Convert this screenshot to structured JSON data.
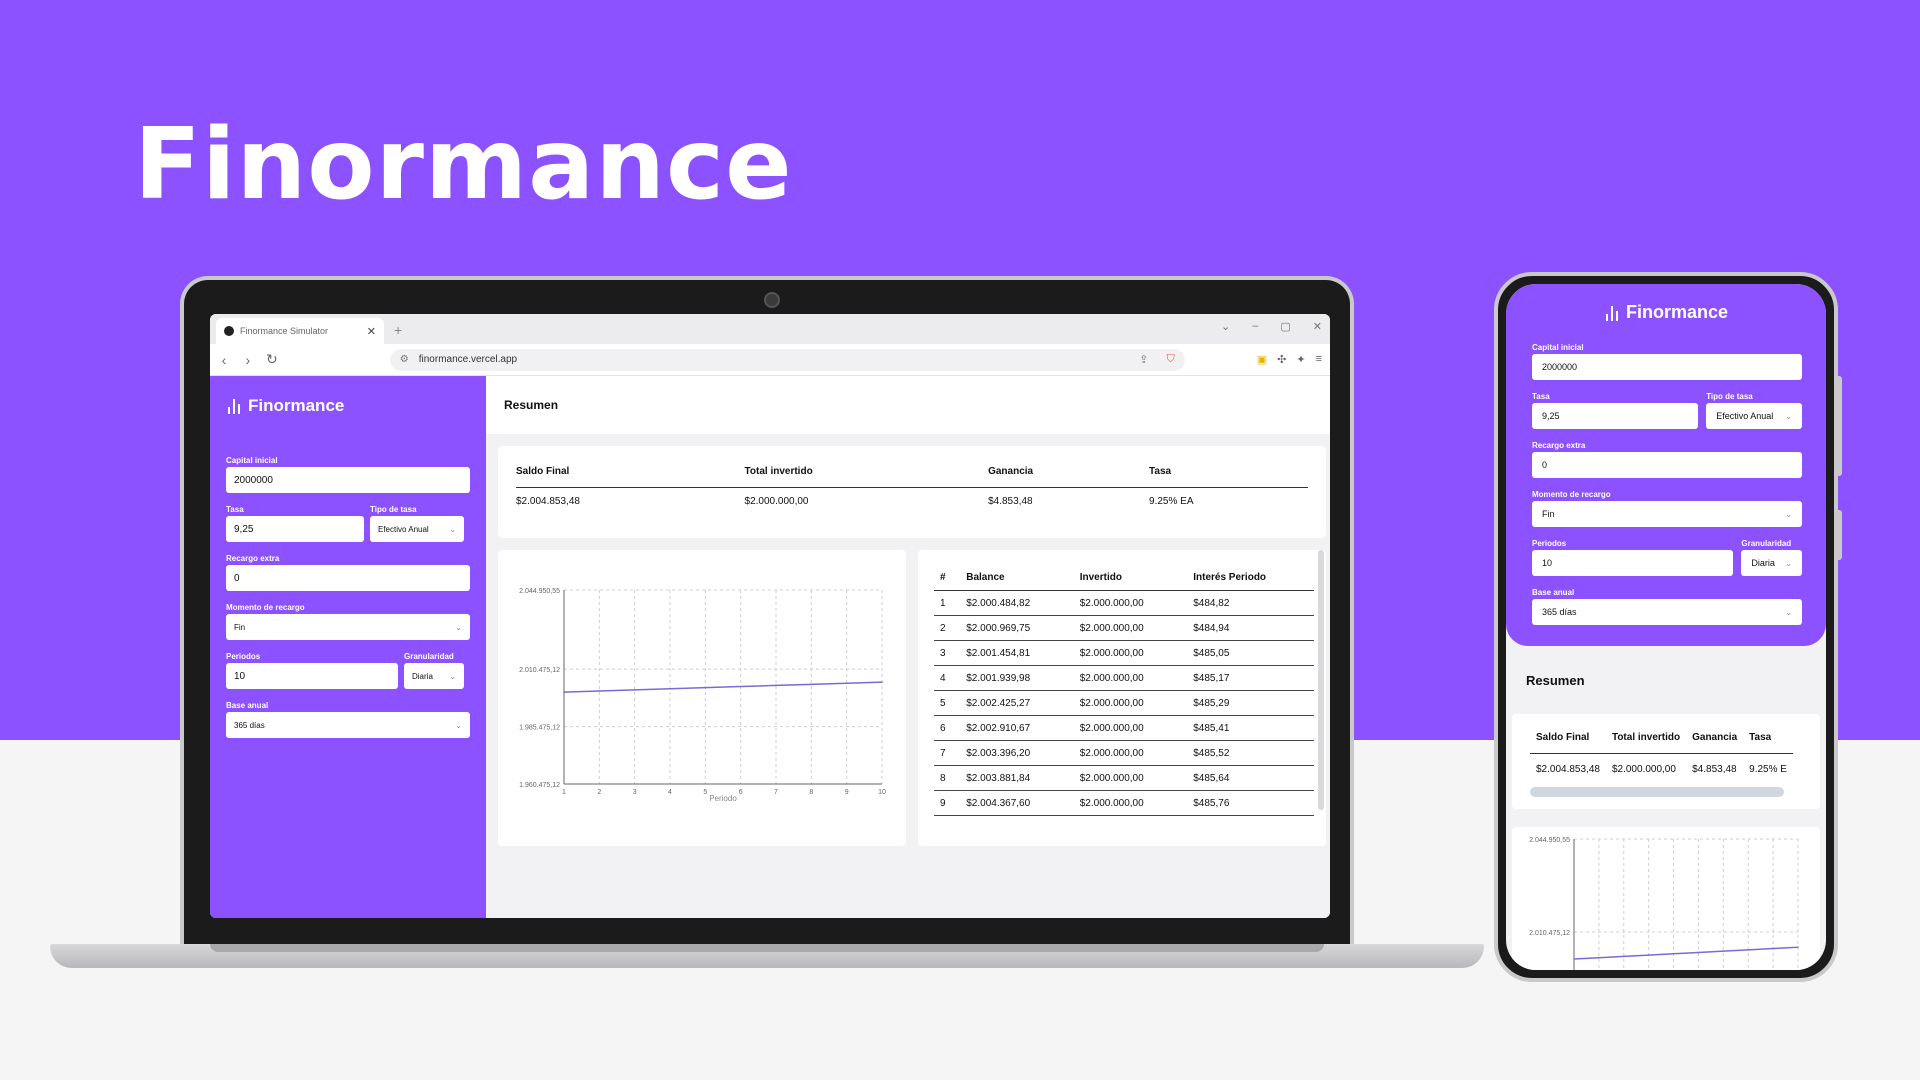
{
  "hero": {
    "title": "Finormance"
  },
  "colors": {
    "brand": "#8c52ff",
    "line": "#7d68d9"
  },
  "browser": {
    "tab_title": "Finormance Simulator",
    "url": "finormance.vercel.app"
  },
  "app": {
    "brand": "Finormance",
    "form": {
      "capital_label": "Capital inicial",
      "capital_value": "2000000",
      "tasa_label": "Tasa",
      "tasa_value": "9,25",
      "tipo_label": "Tipo de tasa",
      "tipo_value": "Efectivo Anual",
      "recargo_label": "Recargo extra",
      "recargo_value": "0",
      "momento_label": "Momento de recargo",
      "momento_value": "Fin",
      "periodos_label": "Periodos",
      "periodos_value": "10",
      "granularidad_label": "Granularidad",
      "granularidad_value": "Diaria",
      "base_label": "Base anual",
      "base_value": "365 días"
    },
    "resumen_title": "Resumen",
    "summary": {
      "headers": [
        "Saldo Final",
        "Total invertido",
        "Ganancia",
        "Tasa"
      ],
      "values": [
        "$2.004.853,48",
        "$2.000.000,00",
        "$4.853,48",
        "9.25% EA"
      ]
    },
    "table": {
      "headers": [
        "#",
        "Balance",
        "Invertido",
        "Interés Periodo"
      ],
      "rows": [
        [
          "1",
          "$2.000.484,82",
          "$2.000.000,00",
          "$484,82"
        ],
        [
          "2",
          "$2.000.969,75",
          "$2.000.000,00",
          "$484,94"
        ],
        [
          "3",
          "$2.001.454,81",
          "$2.000.000,00",
          "$485,05"
        ],
        [
          "4",
          "$2.001.939,98",
          "$2.000.000,00",
          "$485,17"
        ],
        [
          "5",
          "$2.002.425,27",
          "$2.000.000,00",
          "$485,29"
        ],
        [
          "6",
          "$2.002.910,67",
          "$2.000.000,00",
          "$485,41"
        ],
        [
          "7",
          "$2.003.396,20",
          "$2.000.000,00",
          "$485,52"
        ],
        [
          "8",
          "$2.003.881,84",
          "$2.000.000,00",
          "$485,64"
        ],
        [
          "9",
          "$2.004.367,60",
          "$2.000.000,00",
          "$485,76"
        ]
      ]
    }
  },
  "phone": {
    "summary_values": [
      "$2.004.853,48",
      "$2.000.000,00",
      "$4.853,48",
      "9.25% E"
    ],
    "form": {
      "tasa_value": "9,25",
      "base_value": "365 días"
    }
  },
  "chart_data": [
    {
      "type": "line",
      "xlabel": "Periodo",
      "ylabel": "",
      "x": [
        1,
        2,
        3,
        4,
        5,
        6,
        7,
        8,
        9,
        10
      ],
      "x_ticks": [
        "1",
        "2",
        "3",
        "4",
        "5",
        "6",
        "7",
        "8",
        "9",
        "10"
      ],
      "y_ticks": [
        "2.044.950,55",
        "2.010.475,12",
        "1.985.475,12",
        "1.960.475,12"
      ],
      "ylim": [
        1960475.12,
        2044950.55
      ],
      "series": [
        {
          "values": [
            2000484.82,
            2000969.75,
            2001454.81,
            2001939.98,
            2002425.27,
            2002910.67,
            2003396.2,
            2003881.84,
            2004367.6,
            2004853.48
          ]
        }
      ],
      "grid": true
    },
    {
      "type": "line",
      "xlabel": "",
      "ylabel": "",
      "y_ticks": [
        "2.044.950,55",
        "2.010.475,12"
      ],
      "ylim": [
        1960475.12,
        2044950.55
      ],
      "series": [
        {
          "values": [
            2000484.82,
            2000969.75,
            2001454.81,
            2001939.98,
            2002425.27,
            2002910.67,
            2003396.2,
            2003881.84,
            2004367.6,
            2004853.48
          ]
        }
      ],
      "grid": true
    }
  ]
}
